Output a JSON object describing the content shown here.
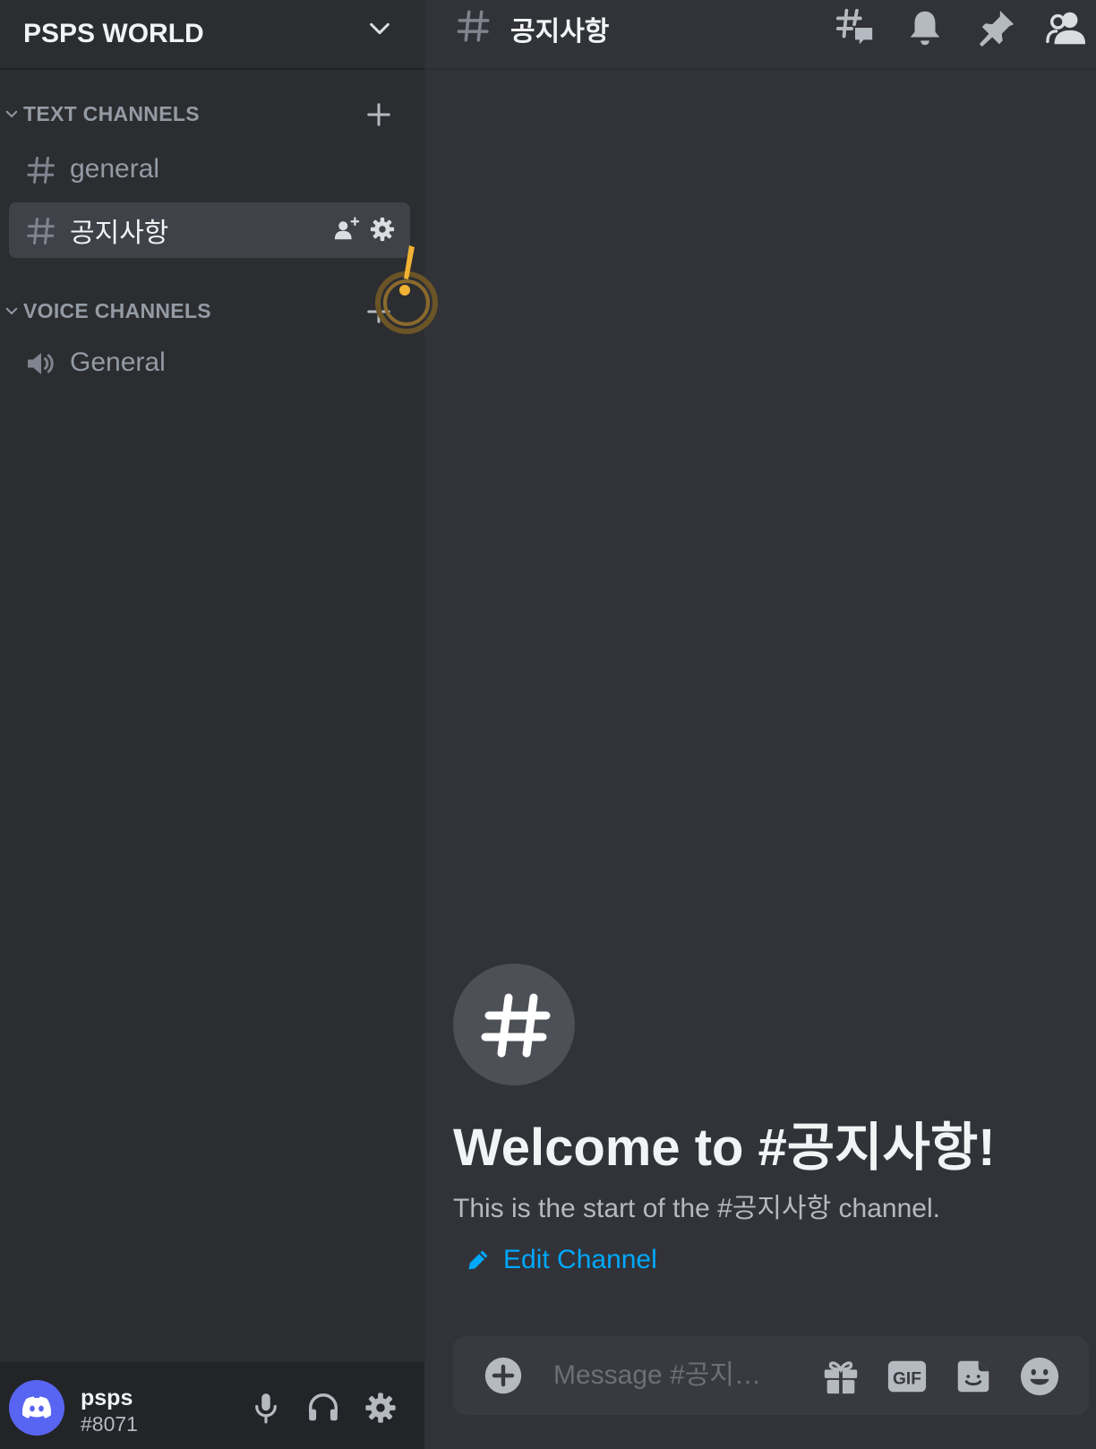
{
  "server": {
    "name": "PSPS WORLD"
  },
  "sidebar": {
    "text_category": "TEXT CHANNELS",
    "voice_category": "VOICE CHANNELS",
    "text_channels": [
      {
        "label": "general",
        "active": false
      },
      {
        "label": "공지사항",
        "active": true
      }
    ],
    "voice_channels": [
      {
        "label": "General"
      }
    ]
  },
  "user": {
    "name": "psps",
    "tag": "#8071"
  },
  "topbar": {
    "channel_title": "공지사항"
  },
  "welcome": {
    "title": "Welcome to #공지사항!",
    "description": "This is the start of the #공지사항 channel.",
    "edit_label": "Edit Channel"
  },
  "composer": {
    "placeholder": "Message #공지…"
  },
  "colors": {
    "accent": "#5865f2",
    "link": "#00a8fc",
    "alert": "#f0b232"
  }
}
